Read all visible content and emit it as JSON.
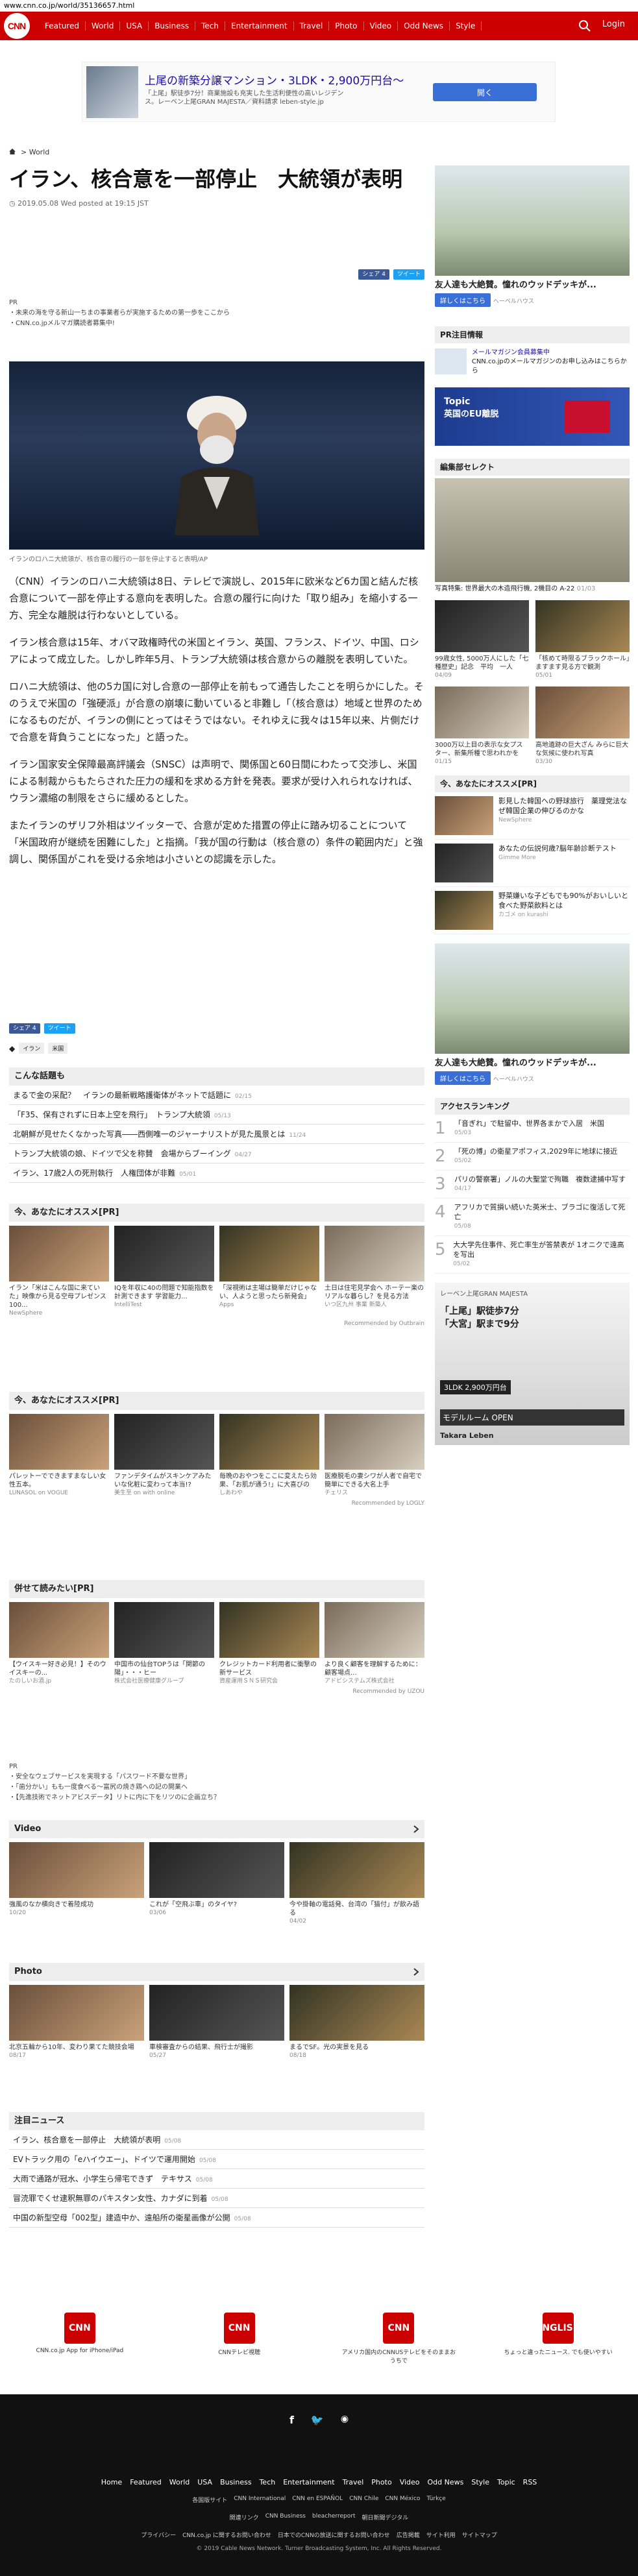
{
  "browser": {
    "url": "www.cnn.co.jp/world/35136657.html"
  },
  "nav": {
    "logo": "CNN",
    "items": [
      "Featured",
      "World",
      "USA",
      "Business",
      "Tech",
      "Entertainment",
      "Travel",
      "Photo",
      "Video",
      "Odd News",
      "Style"
    ],
    "login": "Login"
  },
  "topad": {
    "title": "上尾の新築分譲マンション・3LDK・2,900万円台～",
    "sub": "「上尾」駅徒歩7分！商業施設も充実した生活利便性の高いレジデンス。レーベン上尾GRAN MAJESTA／資料請求 leben-style.jp",
    "button": "開く"
  },
  "breadcrumb": {
    "section": "World"
  },
  "article": {
    "title": "イラン、核合意を一部停止　大統領が表明",
    "date": "2019.05.08 Wed posted at 19:15 JST",
    "share_fb": "シェア 4",
    "share_tw": "ツイート",
    "pr_label": "PR",
    "pr_items": [
      "未来の海を守る新山一ちまの事業者らが実施するための第一歩をここから",
      "CNN.co.jpメルマガ購読者募集中!"
    ],
    "caption": "イランのロハニ大統領が、核合意の履行の一部を停止すると表明/AP",
    "paragraphs": [
      "（CNN）イランのロハニ大統領は8日、テレビで演説し、2015年に欧米など6カ国と結んだ核合意について一部を停止する意向を表明した。合意の履行に向けた「取り組み」を縮小する一方、完全な離脱は行わないとしている。",
      "イラン核合意は15年、オバマ政権時代の米国とイラン、英国、フランス、ドイツ、中国、ロシアによって成立した。しかし昨年5月、トランプ大統領は核合意からの離脱を表明していた。",
      "ロハニ大統領は、他の5カ国に対し合意の一部停止を前もって通告したことを明らかにした。そのうえで米国の「強硬派」が合意の崩壊に動いていると非難し「（核合意は）地域と世界のためになるものだが、イランの側にとってはそうではない。それゆえに我々は15年以来、片側だけで合意を背負うことになった」と語った。",
      "イラン国家安全保障最高評議会（SNSC）は声明で、関係国と60日間にわたって交渉し、米国による制裁からもたらされた圧力の緩和を求める方針を発表。要求が受け入れられなければ、ウラン濃縮の制限をさらに緩めるとした。",
      "またイランのザリフ外相はツイッターで、合意が定めた措置の停止に踏み切ることについて「米国政府が継続を困難にした」と指摘。「我が国の行動は（核合意の）条件の範囲内だ」と強調し、関係国がこれを受ける余地は小さいとの認識を示した。"
    ],
    "tags": [
      "イラン",
      "米国"
    ]
  },
  "topics": {
    "heading": "こんな話題も",
    "rows": [
      {
        "t": "まるで金の采配？　イランの最新戦略護衛体がネットで話題に",
        "d": "02/15"
      },
      {
        "t": "「F35、保有されずに日本上空を飛行」　トランプ大統領",
        "d": "05/13"
      },
      {
        "t": "北朝鮮が見せたくなかった写真――西側唯一のジャーナリストが見た風景とは",
        "d": "11/24"
      },
      {
        "t": "トランプ大統領の娘、ドイツで父を称賛　会場からブーイング",
        "d": "04/27"
      },
      {
        "t": "イラン、17歳2人の死刑執行　人権団体が非難",
        "d": "05/01"
      }
    ]
  },
  "recommend1": {
    "heading": "今、あなたにオススメ[PR]",
    "cards": [
      {
        "t": "イラン「米はこんな国に来ていた」映像から見る空母プレゼンス100...",
        "s": "NewSphere"
      },
      {
        "t": "IQを年収に40の問題で知能指数を計測できます 学習能力...",
        "s": "IntelliTest"
      },
      {
        "t": "「深視術は主場は簡単だけじゃない、人ようと思ったら新発会」",
        "s": "Apps"
      },
      {
        "t": "土日は住宅見学会へ ホーテー楽のリアルな暮らし？を見る方法",
        "s": "いつ区九州 事業 新築人"
      }
    ],
    "by": "Recommended by Outbrain"
  },
  "recommend2": {
    "heading": "今、あなたにオススメ[PR]",
    "cards": [
      {
        "t": "パレットーでできますまなしい女性五本。",
        "s": "LUNASOL on VOGUE"
      },
      {
        "t": "ファンデタイムがスキンケアみたいな化粧に変わって本当!?",
        "s": "美生至 on with online"
      },
      {
        "t": "毎晩のおやつをここに変えたら効果、「お肌が通う!」に大喜びの",
        "s": "しあわや"
      },
      {
        "t": "医療脱毛の妻シワが人者で自宅で簡単にできる大名上手",
        "s": "チェリス"
      }
    ],
    "by": "Recommended by LOGLY"
  },
  "recommend3": {
    "heading": "併せて読みたい[PR]",
    "cards": [
      {
        "t": "【ウイスキー好き必見！】そのウイスキーの...",
        "s": "たのしいお酒.jp"
      },
      {
        "t": "中国市の仙台TOPうは「関節の陽」・・・ヒー",
        "s": "株式会社医療健康グループ"
      },
      {
        "t": "クレジットカード利用者に衝撃の新サービス",
        "s": "資産運用ＳＮＳ研究会"
      },
      {
        "t": "より良く顧客を理解するために：顧客場点...",
        "s": "アドビシステムズ株式会社"
      }
    ],
    "by": "Recommended by UZOU"
  },
  "prlinks": {
    "label": "PR",
    "items": [
      "安全なウェブサービスを実現する「パスワード不要な世界」",
      "「歯分かい」もも一度食べる～富尻の焼き鶏への記の開業へ",
      "【先進技術でネットアビスデータ】リトに内に下をリツのに企画立ち？"
    ]
  },
  "video": {
    "heading": "Video",
    "cards": [
      {
        "t": "強風のなか横向きで着陸成功",
        "d": "10/20"
      },
      {
        "t": "これが「空飛ぶ車」のタイヤ?",
        "d": "03/06"
      },
      {
        "t": "今や掛軸の電話発、台湾の「猫付」が飲み語る",
        "d": "04/02"
      }
    ]
  },
  "photo": {
    "heading": "Photo",
    "cards": [
      {
        "t": "北京五輪から10年、変わり果てた競技会場",
        "d": "08/17"
      },
      {
        "t": "車検審査からの結果、飛行士が撮影",
        "d": "05/27"
      },
      {
        "t": "まるでSF。光の実景を見る",
        "d": "08/18"
      }
    ]
  },
  "news": {
    "heading": "注目ニュース",
    "rows": [
      {
        "t": "イラン、核合意を一部停止　大統領が表明",
        "d": "05/08"
      },
      {
        "t": "EVトラック用の「eハイウエー」、ドイツで運用開始",
        "d": "05/08"
      },
      {
        "t": "大雨で通路が冠水、小学生ら帰宅できず　テキサス",
        "d": "05/08"
      },
      {
        "t": "冒涜罪でくせ逮釈無罪のパキスタン女性、カナダに到着",
        "d": "05/08"
      },
      {
        "t": "中国の新型空母「002型」建造中か、遠船所の衛星画像が公開",
        "d": "05/08"
      }
    ]
  },
  "apps": [
    {
      "n": "CNN",
      "t": "CNN.co.jp App for iPhone/iPad"
    },
    {
      "n": "CNN",
      "t": "CNNテレビ視聴"
    },
    {
      "n": "CNN",
      "t": "アメリカ国内のCNNUSテレビをそのままおうちで"
    },
    {
      "n": "ENGLISH",
      "t": "ちょっと違ったニュース. でも使いやすい"
    }
  ],
  "footer": {
    "links": [
      "Home",
      "Featured",
      "World",
      "USA",
      "Business",
      "Tech",
      "Entertainment",
      "Travel",
      "Photo",
      "Video",
      "Odd News",
      "Style",
      "Topic",
      "RSS"
    ],
    "intl": [
      "各国版サイト",
      "CNN International",
      "CNN en ESPAÑOL",
      "CNN Chile",
      "CNN México",
      "Türkçe"
    ],
    "more": [
      "関連リンク",
      "CNN Business",
      "bleacherreport",
      "朝日新聞デジタル"
    ],
    "legal": [
      "プライバシー",
      "CNN.co.jp に関するお問い合わせ",
      "日本でのCNNの放送に関するお問い合わせ",
      "広告掲載",
      "サイト利用",
      "サイトマップ"
    ],
    "copyright": "© 2019 Cable News Network.  Turner Broadcasting System, Inc.  All Rights Reserved."
  },
  "side": {
    "ad1": {
      "text": "友人達も大絶賛。憧れのウッドデッキが...",
      "btn": "詳しくはこちら",
      "src": "へーベルハウス"
    },
    "prheading": "PR注目情報",
    "pritems": [
      "メールマガジン会員募集中",
      "CNN.co.jpのメールマガジンのお申し込みはこちらから"
    ],
    "topic": {
      "a": "Topic",
      "b": "英国のEU離脱"
    },
    "editorheading": "編集部セレクト",
    "editormain": {
      "t": "写真特集: 世界最大の木造飛行機, 2機目の A-22",
      "d": "01/03"
    },
    "editor": [
      {
        "t": "99歳女性, 5000万人にした「七種歴史」記念　平均　一人",
        "d": "04/09"
      },
      {
        "t": "「核めて時限るブラックホール」ますます見る方で観測",
        "d": "05/01"
      },
      {
        "t": "3000万以上目の表示な女プスター、新集所種で思われかを",
        "d": "01/15"
      },
      {
        "t": "高地遺跡の巨大ざん みらに巨大な気候に使われ写真",
        "d": "03/30"
      }
    ],
    "recheading": "今、あなたにオススメ[PR]",
    "rec": [
      {
        "t": "影見した韓国への野球旅行　薬理党法なぜ韓国企業の伸びるのかな",
        "s": "NewSphere"
      },
      {
        "t": "あなたの伝説何歳?脳年齢診断テスト",
        "s": "Gimme More"
      },
      {
        "t": "野菜嫌いな子どもでも90%がおいしいと食べた野菜飲料とは",
        "s": "カゴメ on kurashi"
      }
    ],
    "rankheading": "アクセスランキング",
    "rank": [
      {
        "t": "「音ぎれ」で駐留中、世界各まかで入居　米国",
        "d": "05/03"
      },
      {
        "t": "「死の博」の衛星アポフィス,2029年に地球に接近",
        "d": "05/02"
      },
      {
        "t": "パリの警察署」ノルの大聖堂で殉職　複数逮捕中写す",
        "d": "04/17"
      },
      {
        "t": "アフリカで質損い続いた英米士、ブラゴに復活して死亡",
        "d": "05/08"
      },
      {
        "t": "大大学先住事件、死亡率生が答禁表が 1オニクで遠高を写出",
        "d": "05/02"
      }
    ],
    "ad2": {
      "a": "レーベン上尾GRAN MAJESTA",
      "b": "「上尾」駅徒歩7分",
      "c": "「大宮」駅まで9分",
      "d": "3LDK 2,900万円台",
      "e": "モデルルーム OPEN",
      "f": "Takara Leben"
    }
  },
  "colors": {
    "brand": "#cc0000",
    "fb": "#3b5998",
    "tw": "#1da1f2"
  }
}
